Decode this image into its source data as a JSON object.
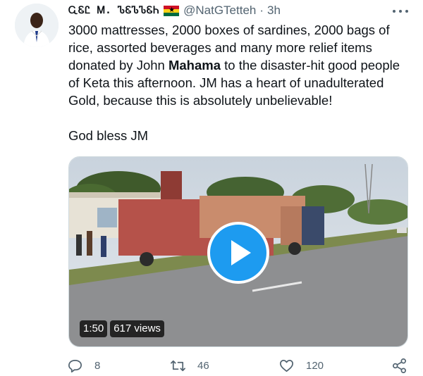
{
  "author": {
    "display_name": "ᏩᏋᏝ Ꮇ. ᏖᏋᏖᏖᏋᏂ",
    "handle": "@NatGTetteh",
    "separator": "·",
    "time": "3h",
    "flag": "ghana-flag"
  },
  "tweet": {
    "text_before": "3000 mattresses, 2000 boxes of sardines, 2000 bags of rice, assorted beverages and many more relief items donated by John ",
    "text_bold": "Mahama",
    "text_after": " to the disaster-hit good people of Keta this afternoon. JM has a heart of unadulterated Gold, because this is absolutely unbelievable!",
    "text_closing": "God bless JM"
  },
  "video": {
    "duration": "1:50",
    "views": "617 views"
  },
  "actions": {
    "reply_count": "8",
    "retweet_count": "46",
    "like_count": "120"
  },
  "colors": {
    "accent": "#1d9bf0",
    "secondary_text": "#536471"
  }
}
